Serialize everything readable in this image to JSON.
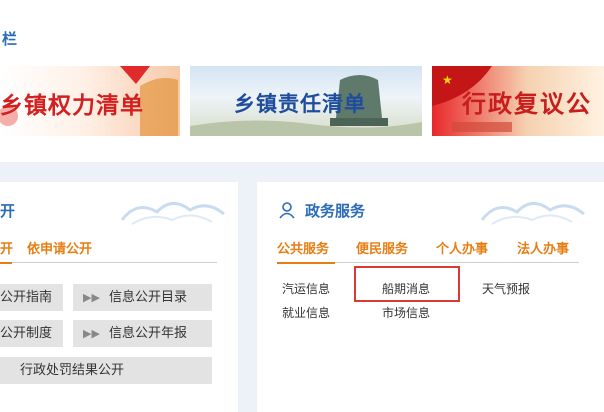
{
  "top": {
    "section_title": "栏",
    "banners": [
      {
        "text": "乡镇权力清单"
      },
      {
        "text": "乡镇责任清单"
      },
      {
        "text": "行政复议公"
      }
    ]
  },
  "left_panel": {
    "title": "开",
    "tabs": [
      "开",
      "依申请公开"
    ],
    "buttons": [
      "公开指南",
      "信息公开目录",
      "公开制度",
      "信息公开年报",
      "行政处罚结果公开"
    ]
  },
  "right_panel": {
    "title": "政务服务",
    "tabs": [
      "公共服务",
      "便民服务",
      "个人办事",
      "法人办事"
    ],
    "links": [
      "汽运信息",
      "船期消息",
      "天气预报",
      "就业信息",
      "市场信息"
    ]
  },
  "colors": {
    "accent": "#2a6cb5",
    "tab_orange": "#e67e14",
    "highlight": "#d93a36"
  }
}
